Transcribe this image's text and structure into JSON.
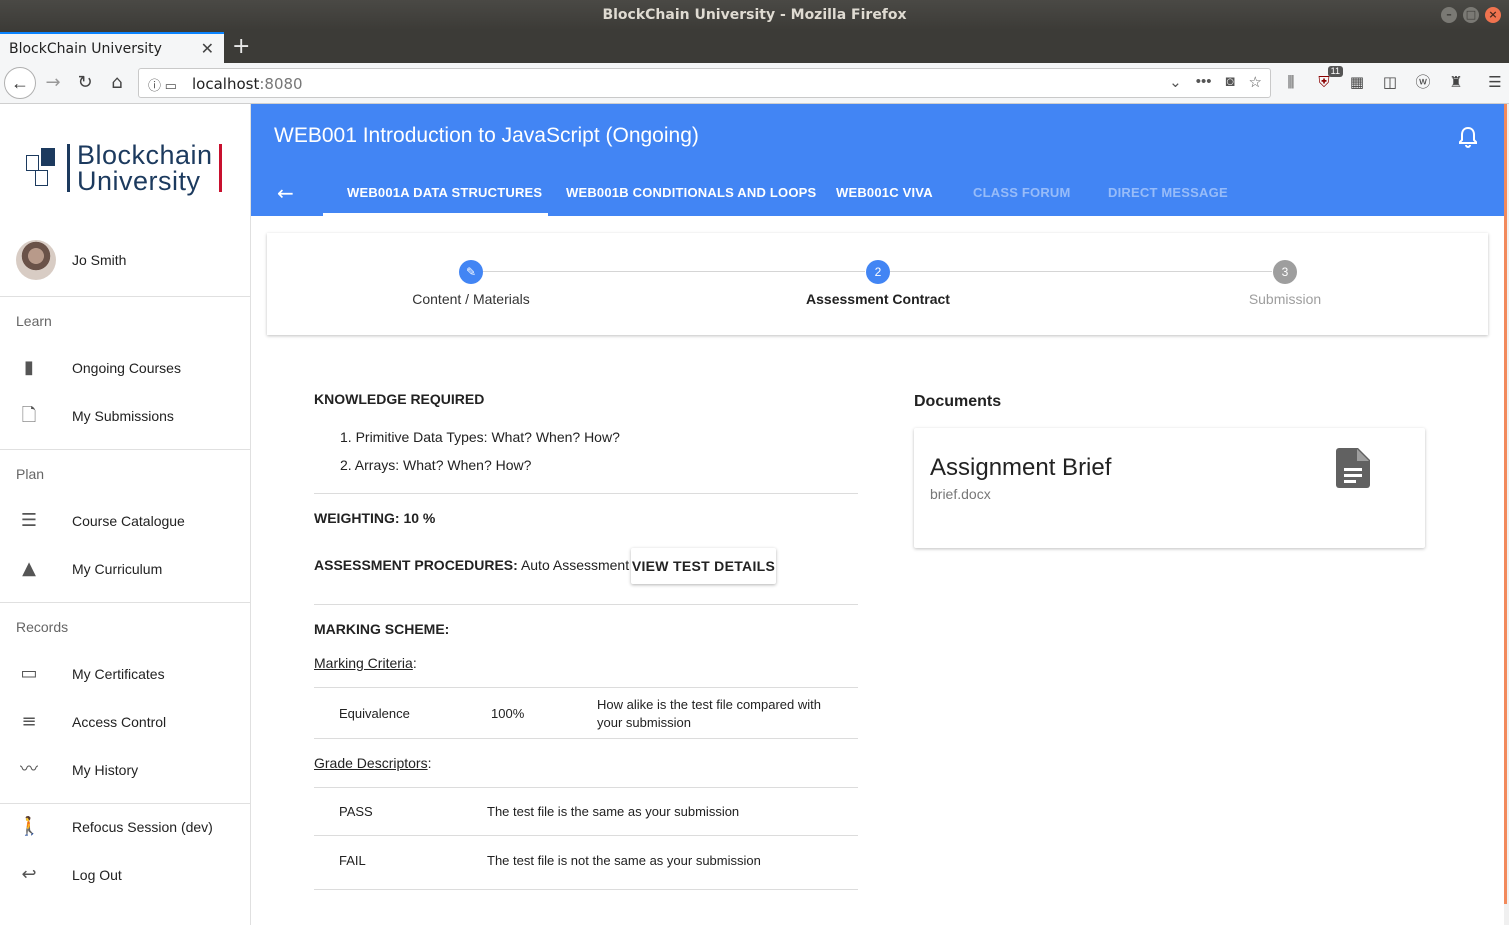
{
  "window": {
    "title": "BlockChain University - Mozilla Firefox"
  },
  "browser": {
    "tab_title": "BlockChain University",
    "url_host": "localhost",
    "url_port": ":8080",
    "badge_count": "11"
  },
  "sidebar": {
    "logo_line1": "Blockchain",
    "logo_line2": "University",
    "user_name": "Jo Smith",
    "sections": [
      {
        "header": "Learn",
        "items": [
          {
            "label": "Ongoing Courses",
            "icon": "book-icon"
          },
          {
            "label": "My Submissions",
            "icon": "file-plus-icon"
          }
        ]
      },
      {
        "header": "Plan",
        "items": [
          {
            "label": "Course Catalogue",
            "icon": "list-icon"
          },
          {
            "label": "My Curriculum",
            "icon": "school-icon"
          }
        ]
      },
      {
        "header": "Records",
        "items": [
          {
            "label": "My Certificates",
            "icon": "certificate-icon"
          },
          {
            "label": "Access Control",
            "icon": "tune-icon"
          },
          {
            "label": "My History",
            "icon": "trending-icon"
          }
        ]
      }
    ],
    "bottom": [
      {
        "label": "Refocus Session (dev)",
        "icon": "walk-icon"
      },
      {
        "label": "Log Out",
        "icon": "reply-icon"
      }
    ]
  },
  "appbar": {
    "title": "WEB001 Introduction to JavaScript (Ongoing)",
    "tabs": [
      {
        "label": "WEB001A DATA STRUCTURES",
        "active": true
      },
      {
        "label": "WEB001B CONDITIONALS AND LOOPS"
      },
      {
        "label": "WEB001C VIVA"
      },
      {
        "label": "CLASS FORUM",
        "disabled": true
      },
      {
        "label": "DIRECT MESSAGE",
        "disabled": true
      }
    ]
  },
  "stepper": {
    "steps": [
      {
        "label": "Content / Materials",
        "marker": "✎",
        "state": "done"
      },
      {
        "label": "Assessment Contract",
        "marker": "2",
        "state": "active"
      },
      {
        "label": "Submission",
        "marker": "3",
        "state": "pending"
      }
    ]
  },
  "contract": {
    "knowledge_heading": "KNOWLEDGE REQUIRED",
    "knowledge_items": [
      "1. Primitive Data Types: What? When? How?",
      "2. Arrays: What? When? How?"
    ],
    "weighting_label": "WEIGHTING:",
    "weighting_value": "10 %",
    "procedures_label": "ASSESSMENT PROCEDURES:",
    "procedures_value": "Auto Assessment",
    "view_button": "VIEW TEST DETAILS",
    "marking_heading": "MARKING SCHEME:",
    "criteria_link": "Marking Criteria",
    "criteria": [
      {
        "name": "Equivalence",
        "weight": "100%",
        "description_line1": "How alike is the test file compared with",
        "description_line2": "your submission"
      }
    ],
    "descriptors_link": "Grade Descriptors",
    "descriptors": [
      {
        "grade": "PASS",
        "description": "The test file is the same as your submission"
      },
      {
        "grade": "FAIL",
        "description": "The test file is not the same as your submission"
      }
    ],
    "colon": ":"
  },
  "documents": {
    "heading": "Documents",
    "items": [
      {
        "title": "Assignment Brief",
        "filename": "brief.docx",
        "icon": "document-icon"
      }
    ]
  },
  "colors": {
    "primary": "#4285f4",
    "brand_navy": "#1c3a5e",
    "brand_red": "#c8102e"
  }
}
